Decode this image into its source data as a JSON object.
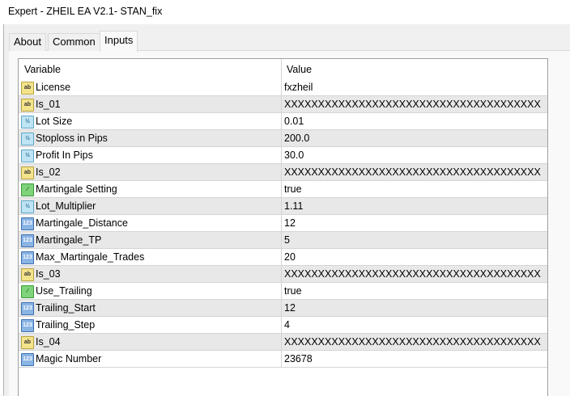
{
  "window": {
    "title": "Expert - ZHEIL EA V2.1- STAN_fix"
  },
  "tabs": [
    {
      "label": "About"
    },
    {
      "label": "Common"
    },
    {
      "label": "Inputs",
      "active": true
    }
  ],
  "table": {
    "headers": {
      "variable": "Variable",
      "value": "Value"
    },
    "rows": [
      {
        "icon": "string-icon",
        "glyph": "ab",
        "name": "License",
        "value": "fxzheil"
      },
      {
        "icon": "string-icon",
        "glyph": "ab",
        "name": "Is_01",
        "value": "XXXXXXXXXXXXXXXXXXXXXXXXXXXXXXXXXXXXXX..."
      },
      {
        "icon": "double-icon",
        "glyph": "½",
        "name": "Lot Size",
        "value": "0.01"
      },
      {
        "icon": "double-icon",
        "glyph": "½",
        "name": "Stoploss in Pips",
        "value": "200.0"
      },
      {
        "icon": "double-icon",
        "glyph": "½",
        "name": "Profit In Pips",
        "value": "30.0"
      },
      {
        "icon": "string-icon",
        "glyph": "ab",
        "name": "Is_02",
        "value": "XXXXXXXXXXXXXXXXXXXXXXXXXXXXXXXXXXXXXX..."
      },
      {
        "icon": "bool-icon",
        "glyph": "⁄",
        "name": "Martingale Setting",
        "value": "true"
      },
      {
        "icon": "double-icon",
        "glyph": "½",
        "name": "Lot_Multiplier",
        "value": "1.11"
      },
      {
        "icon": "integer-icon",
        "glyph": "123",
        "name": "Martingale_Distance",
        "value": "12"
      },
      {
        "icon": "integer-icon",
        "glyph": "123",
        "name": "Martingale_TP",
        "value": "5"
      },
      {
        "icon": "integer-icon",
        "glyph": "123",
        "name": "Max_Martingale_Trades",
        "value": "20"
      },
      {
        "icon": "string-icon",
        "glyph": "ab",
        "name": "Is_03",
        "value": "XXXXXXXXXXXXXXXXXXXXXXXXXXXXXXXXXXXXXX..."
      },
      {
        "icon": "bool-icon",
        "glyph": "⁄",
        "name": "Use_Trailing",
        "value": "true"
      },
      {
        "icon": "integer-icon",
        "glyph": "123",
        "name": "Trailing_Start",
        "value": "12"
      },
      {
        "icon": "integer-icon",
        "glyph": "123",
        "name": "Trailing_Step",
        "value": "4"
      },
      {
        "icon": "string-icon",
        "glyph": "ab",
        "name": "Is_04",
        "value": "XXXXXXXXXXXXXXXXXXXXXXXXXXXXXXXXXXXXXX..."
      },
      {
        "icon": "integer-icon",
        "glyph": "123",
        "name": "Magic Number",
        "value": "23678"
      }
    ]
  }
}
